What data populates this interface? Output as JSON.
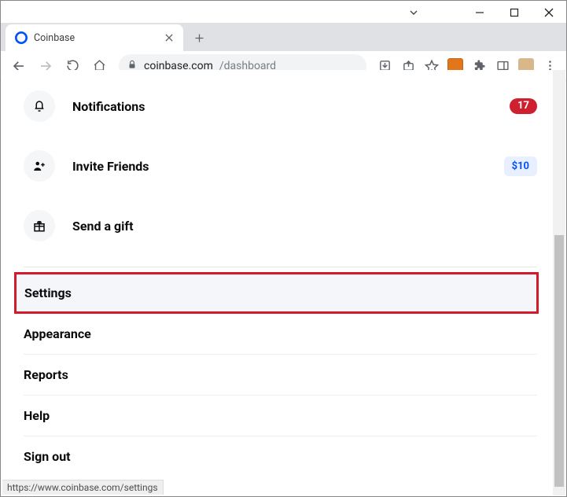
{
  "window": {
    "tab_title": "Coinbase",
    "url_host": "coinbase.com",
    "url_path": "/dashboard"
  },
  "rows": {
    "notifications": {
      "label": "Notifications",
      "count": "17"
    },
    "invite": {
      "label": "Invite Friends",
      "reward": "$10"
    },
    "gift": {
      "label": "Send a gift"
    }
  },
  "menu": {
    "settings": "Settings",
    "appearance": "Appearance",
    "reports": "Reports",
    "help": "Help",
    "signout": "Sign out"
  },
  "status_url": "https://www.coinbase.com/settings"
}
